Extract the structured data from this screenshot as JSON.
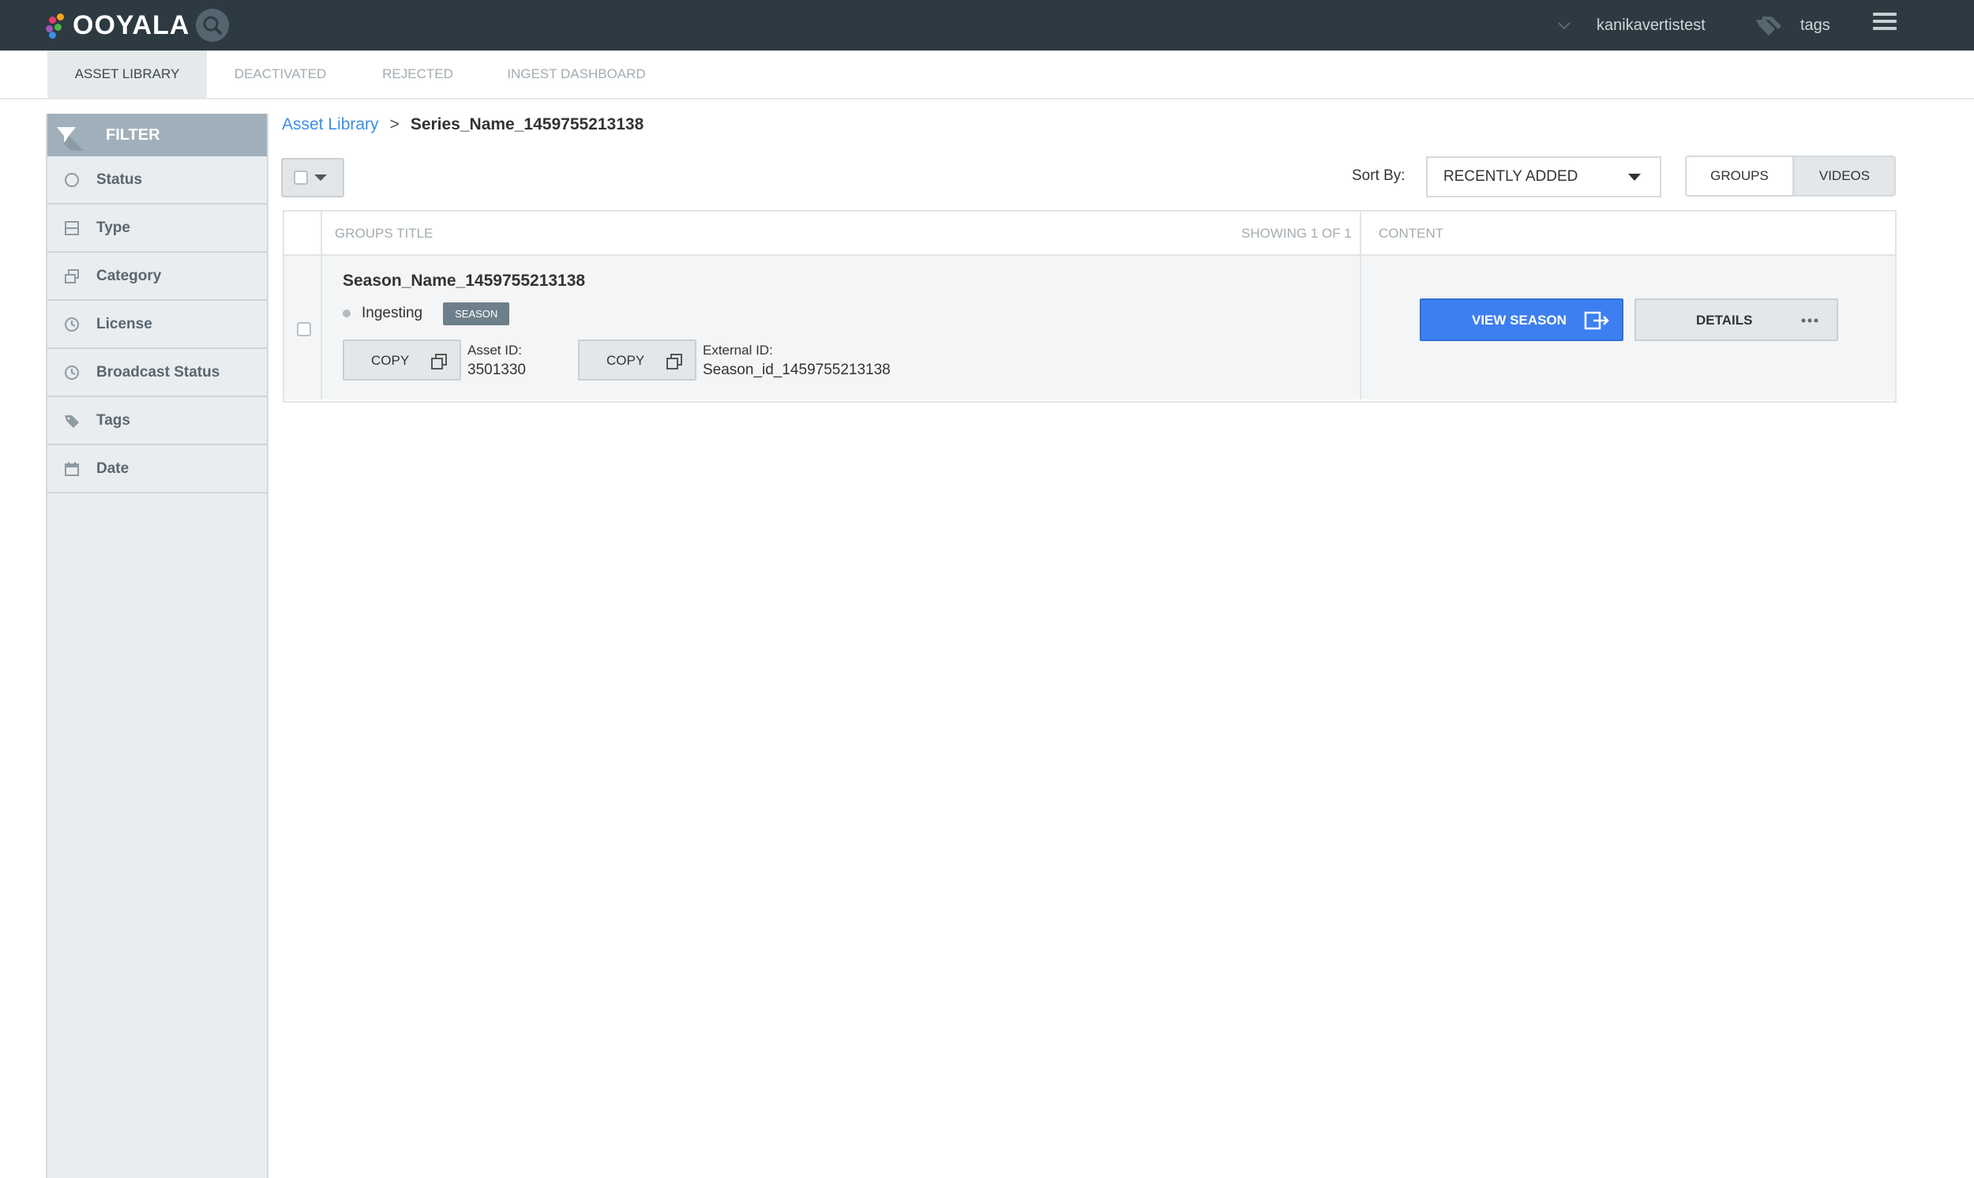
{
  "app": {
    "logo_text": "OOYALA",
    "username": "kanikavertistest",
    "tags_label": "tags"
  },
  "tabs": [
    {
      "label": "ASSET LIBRARY",
      "active": true
    },
    {
      "label": "DEACTIVATED",
      "active": false
    },
    {
      "label": "REJECTED",
      "active": false
    },
    {
      "label": "INGEST DASHBOARD",
      "active": false
    }
  ],
  "sidebar": {
    "header": "FILTER",
    "items": [
      {
        "label": "Status",
        "icon": "circle-icon"
      },
      {
        "label": "Type",
        "icon": "type-icon"
      },
      {
        "label": "Category",
        "icon": "category-icon"
      },
      {
        "label": "License",
        "icon": "clock-icon"
      },
      {
        "label": "Broadcast Status",
        "icon": "clock-icon"
      },
      {
        "label": "Tags",
        "icon": "tag-icon"
      },
      {
        "label": "Date",
        "icon": "calendar-icon"
      }
    ]
  },
  "breadcrumb": {
    "root": "Asset Library",
    "separator": ">",
    "current": "Series_Name_1459755213138"
  },
  "toolbar": {
    "sort_label": "Sort By:",
    "sort_value": "RECENTLY ADDED",
    "view_groups": "GROUPS",
    "view_videos": "VIDEOS"
  },
  "table": {
    "col_title": "GROUPS TITLE",
    "showing": "SHOWING 1 OF 1",
    "col_content": "CONTENT",
    "rows": [
      {
        "title": "Season_Name_1459755213138",
        "status": "Ingesting",
        "badge": "SEASON",
        "copy_label": "COPY",
        "asset_id_label": "Asset ID:",
        "asset_id": "3501330",
        "external_id_label": "External ID:",
        "external_id": "Season_id_1459755213138",
        "view_label": "VIEW SEASON",
        "details_label": "DETAILS"
      }
    ]
  },
  "colors": {
    "topbar": "#2d3a42",
    "accent_blue": "#3d7ff0",
    "filter_header": "#a0b0bb",
    "sidebar_bg": "#e9edf0",
    "logo_dots": [
      "#e63b6f",
      "#f5a623",
      "#4cb848",
      "#3a8ee6",
      "#9b59b6"
    ]
  }
}
